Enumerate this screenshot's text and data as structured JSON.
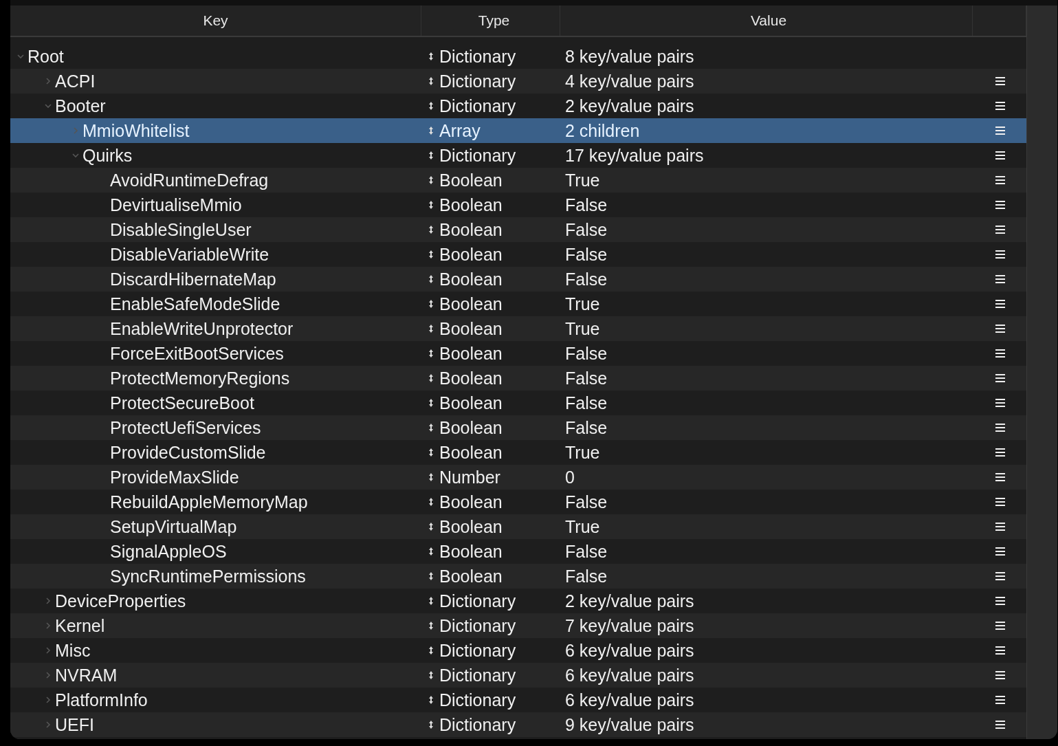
{
  "columns": [
    "Key",
    "Type",
    "Value"
  ],
  "tree": [
    {
      "key": "Root",
      "type": "Dictionary",
      "value": "8 key/value pairs",
      "expanded": true,
      "selected": false,
      "children": [
        {
          "key": "ACPI",
          "type": "Dictionary",
          "value": "4 key/value pairs",
          "expanded": false,
          "selected": false
        },
        {
          "key": "Booter",
          "type": "Dictionary",
          "value": "2 key/value pairs",
          "expanded": true,
          "selected": false,
          "children": [
            {
              "key": "MmioWhitelist",
              "type": "Array",
              "value": "2 children",
              "expanded": false,
              "selected": true
            },
            {
              "key": "Quirks",
              "type": "Dictionary",
              "value": "17 key/value pairs",
              "expanded": true,
              "selected": false,
              "children": [
                {
                  "key": "AvoidRuntimeDefrag",
                  "type": "Boolean",
                  "value": "True",
                  "selected": false
                },
                {
                  "key": "DevirtualiseMmio",
                  "type": "Boolean",
                  "value": "False",
                  "selected": false
                },
                {
                  "key": "DisableSingleUser",
                  "type": "Boolean",
                  "value": "False",
                  "selected": false
                },
                {
                  "key": "DisableVariableWrite",
                  "type": "Boolean",
                  "value": "False",
                  "selected": false
                },
                {
                  "key": "DiscardHibernateMap",
                  "type": "Boolean",
                  "value": "False",
                  "selected": false
                },
                {
                  "key": "EnableSafeModeSlide",
                  "type": "Boolean",
                  "value": "True",
                  "selected": false
                },
                {
                  "key": "EnableWriteUnprotector",
                  "type": "Boolean",
                  "value": "True",
                  "selected": false
                },
                {
                  "key": "ForceExitBootServices",
                  "type": "Boolean",
                  "value": "False",
                  "selected": false
                },
                {
                  "key": "ProtectMemoryRegions",
                  "type": "Boolean",
                  "value": "False",
                  "selected": false
                },
                {
                  "key": "ProtectSecureBoot",
                  "type": "Boolean",
                  "value": "False",
                  "selected": false
                },
                {
                  "key": "ProtectUefiServices",
                  "type": "Boolean",
                  "value": "False",
                  "selected": false
                },
                {
                  "key": "ProvideCustomSlide",
                  "type": "Boolean",
                  "value": "True",
                  "selected": false
                },
                {
                  "key": "ProvideMaxSlide",
                  "type": "Number",
                  "value": "0",
                  "selected": false
                },
                {
                  "key": "RebuildAppleMemoryMap",
                  "type": "Boolean",
                  "value": "False",
                  "selected": false
                },
                {
                  "key": "SetupVirtualMap",
                  "type": "Boolean",
                  "value": "True",
                  "selected": false
                },
                {
                  "key": "SignalAppleOS",
                  "type": "Boolean",
                  "value": "False",
                  "selected": false
                },
                {
                  "key": "SyncRuntimePermissions",
                  "type": "Boolean",
                  "value": "False",
                  "selected": false
                }
              ]
            }
          ]
        },
        {
          "key": "DeviceProperties",
          "type": "Dictionary",
          "value": "2 key/value pairs",
          "expanded": false,
          "selected": false
        },
        {
          "key": "Kernel",
          "type": "Dictionary",
          "value": "7 key/value pairs",
          "expanded": false,
          "selected": false
        },
        {
          "key": "Misc",
          "type": "Dictionary",
          "value": "6 key/value pairs",
          "expanded": false,
          "selected": false
        },
        {
          "key": "NVRAM",
          "type": "Dictionary",
          "value": "6 key/value pairs",
          "expanded": false,
          "selected": false
        },
        {
          "key": "PlatformInfo",
          "type": "Dictionary",
          "value": "6 key/value pairs",
          "expanded": false,
          "selected": false
        },
        {
          "key": "UEFI",
          "type": "Dictionary",
          "value": "9 key/value pairs",
          "expanded": false,
          "selected": false
        }
      ]
    }
  ]
}
